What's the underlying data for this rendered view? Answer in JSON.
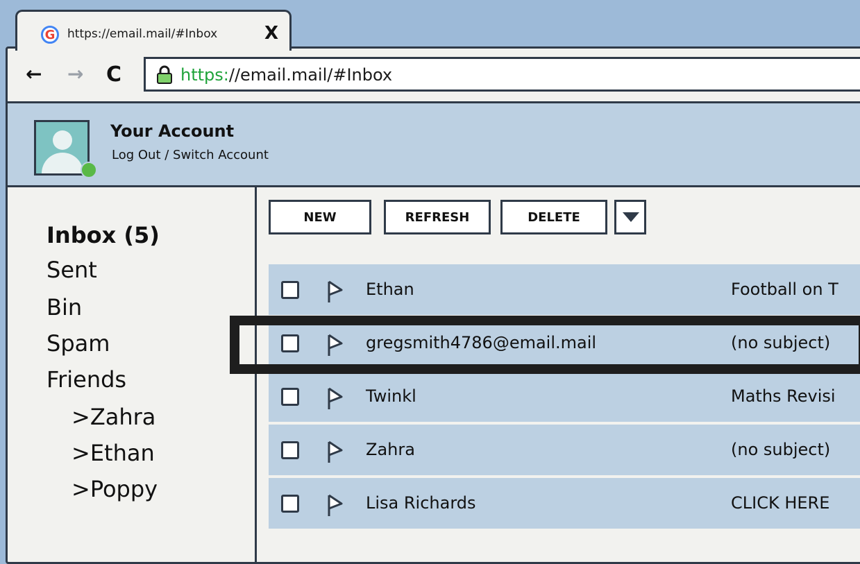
{
  "tab": {
    "title": "https://email.mail/#Inbox",
    "close_glyph": "X",
    "favicon_letter": "G",
    "favicon_icon": "google-favicon-icon"
  },
  "toolbar": {
    "back_glyph": "←",
    "forward_glyph": "→",
    "reload_glyph": "C",
    "url_scheme": "https:",
    "url_rest": "//email.mail/#Inbox"
  },
  "account": {
    "name": "Your Account",
    "switch_text": "Log Out / Switch Account",
    "status_color": "#59b947"
  },
  "sidebar": {
    "folders": [
      "Inbox (5)",
      "Sent",
      "Bin",
      "Spam",
      "Friends"
    ],
    "subfolders": [
      ">Zahra",
      ">Ethan",
      ">Poppy"
    ]
  },
  "actions": {
    "new": "NEW",
    "refresh": "REFRESH",
    "delete": "DELETE"
  },
  "emails": [
    {
      "sender": "Ethan",
      "subject": "Football on T"
    },
    {
      "sender": "gregsmith4786@email.mail",
      "subject": "(no subject)",
      "highlighted": true
    },
    {
      "sender": "Twinkl",
      "subject": "Maths Revisi"
    },
    {
      "sender": "Zahra",
      "subject": "(no subject)"
    },
    {
      "sender": "Lisa Richards",
      "subject": "CLICK HERE"
    }
  ],
  "colors": {
    "page_bg": "#9dbad8",
    "panel": "#bcd0e2",
    "outline": "#2f3a48",
    "https_green": "#1fa33a"
  }
}
